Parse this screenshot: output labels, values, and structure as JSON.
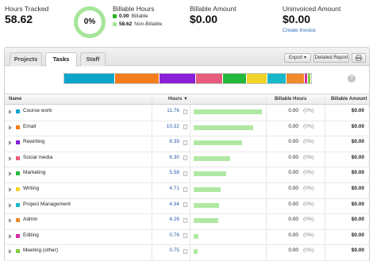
{
  "summary": {
    "hours_tracked_label": "Hours Tracked",
    "hours_tracked_value": "58.62",
    "donut_percent": "0%",
    "billable_hours_label": "Billable Hours",
    "billable_value": "0.00",
    "billable_label": "Billable",
    "non_billable_value": "58.62",
    "non_billable_label": "Non-Billable",
    "billable_color": "#2bb52b",
    "non_billable_color": "#a6e59a",
    "billable_amount_label": "Billable Amount",
    "billable_amount_value": "$0.00",
    "uninvoiced_label": "Uninvoiced Amount",
    "uninvoiced_value": "$0.00",
    "create_invoice": "Create Invoice"
  },
  "tabs": [
    {
      "label": "Projects",
      "active": false
    },
    {
      "label": "Tasks",
      "active": true
    },
    {
      "label": "Staff",
      "active": false
    }
  ],
  "toolbar": {
    "export_label": "Export ▾",
    "detailed_report_label": "Detailed Report",
    "print_icon": "print-icon"
  },
  "help_glyph": "?",
  "columns": {
    "name": "Name",
    "hours": "Hours ▼",
    "billable_hours": "Billable Hours",
    "billable_amount": "Billable Amount"
  },
  "max_hours": 11.76,
  "rows": [
    {
      "name": "Course work",
      "hours": "11.76",
      "value": 11.76,
      "color": "#0ea5cc",
      "billable": "0.00",
      "pct": "(0%)",
      "amount": "$0.00"
    },
    {
      "name": "Email",
      "hours": "10.32",
      "value": 10.32,
      "color": "#f47c1a",
      "billable": "0.00",
      "pct": "(0%)",
      "amount": "$0.00"
    },
    {
      "name": "Rewriting",
      "hours": "8.39",
      "value": 8.39,
      "color": "#8a1fd6",
      "billable": "0.00",
      "pct": "(0%)",
      "amount": "$0.00"
    },
    {
      "name": "Social media",
      "hours": "6.30",
      "value": 6.3,
      "color": "#e85b7c",
      "billable": "0.00",
      "pct": "(0%)",
      "amount": "$0.00"
    },
    {
      "name": "Marketing",
      "hours": "5.58",
      "value": 5.58,
      "color": "#22b83c",
      "billable": "0.00",
      "pct": "(0%)",
      "amount": "$0.00"
    },
    {
      "name": "Writing",
      "hours": "4.71",
      "value": 4.71,
      "color": "#f2d428",
      "billable": "0.00",
      "pct": "(0%)",
      "amount": "$0.00"
    },
    {
      "name": "Project Management",
      "hours": "4.34",
      "value": 4.34,
      "color": "#19b8c9",
      "billable": "0.00",
      "pct": "(0%)",
      "amount": "$0.00"
    },
    {
      "name": "Admin",
      "hours": "4.26",
      "value": 4.26,
      "color": "#f08a2a",
      "billable": "0.00",
      "pct": "(0%)",
      "amount": "$0.00"
    },
    {
      "name": "Editing",
      "hours": "0.76",
      "value": 0.76,
      "color": "#d42ea8",
      "billable": "0.00",
      "pct": "(0%)",
      "amount": "$0.00"
    },
    {
      "name": "Meeting (other)",
      "hours": "0.75",
      "value": 0.75,
      "color": "#7fcf3a",
      "billable": "0.00",
      "pct": "(0%)",
      "amount": "$0.00"
    }
  ]
}
